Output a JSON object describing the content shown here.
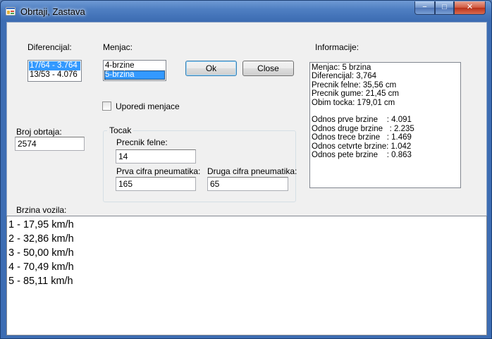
{
  "window": {
    "title": "Obrtaji, Zastava",
    "controls": {
      "minimize": "−",
      "maximize": "□",
      "close": "✕"
    }
  },
  "diferencijal": {
    "label": "Diferencijal:",
    "items": [
      "17/64 - 3.764",
      "13/53 - 4.076"
    ],
    "selected_index": 0
  },
  "menjac": {
    "label": "Menjac:",
    "items": [
      "4-brzine",
      "5-brzina"
    ],
    "selected_index": 1
  },
  "buttons": {
    "ok": "Ok",
    "close": "Close"
  },
  "uporedi": {
    "label": "Uporedi menjace",
    "checked": false
  },
  "broj_obrtaja": {
    "label": "Broj obrtaja:",
    "value": "2574"
  },
  "tocak": {
    "title": "Tocak",
    "precnik_felne_label": "Precnik felne:",
    "precnik_felne_value": "14",
    "prva_cifra_label": "Prva cifra pneumatika:",
    "prva_cifra_value": "165",
    "druga_cifra_label": "Druga cifra pneumatika:",
    "druga_cifra_value": "65"
  },
  "informacije": {
    "label": "Informacije:",
    "text": "Menjac: 5 brzina\nDiferencijal: 3,764\nPrecnik felne: 35,56 cm\nPrecnik gume: 21,45 cm\nObim tocka: 179,01 cm\n\nOdnos prve brzine    : 4.091\nOdnos druge brzine   : 2.235\nOdnos trece brzine   : 1.469\nOdnos cetvrte brzine: 1.042\nOdnos pete brzine    : 0.863"
  },
  "brzina": {
    "label": "Brzina vozila:",
    "lines": [
      "1 - 17,95 km/h",
      "2 - 32,86 km/h",
      "3 - 50,00 km/h",
      "4 - 70,49 km/h",
      "5 - 85,11 km/h"
    ]
  }
}
